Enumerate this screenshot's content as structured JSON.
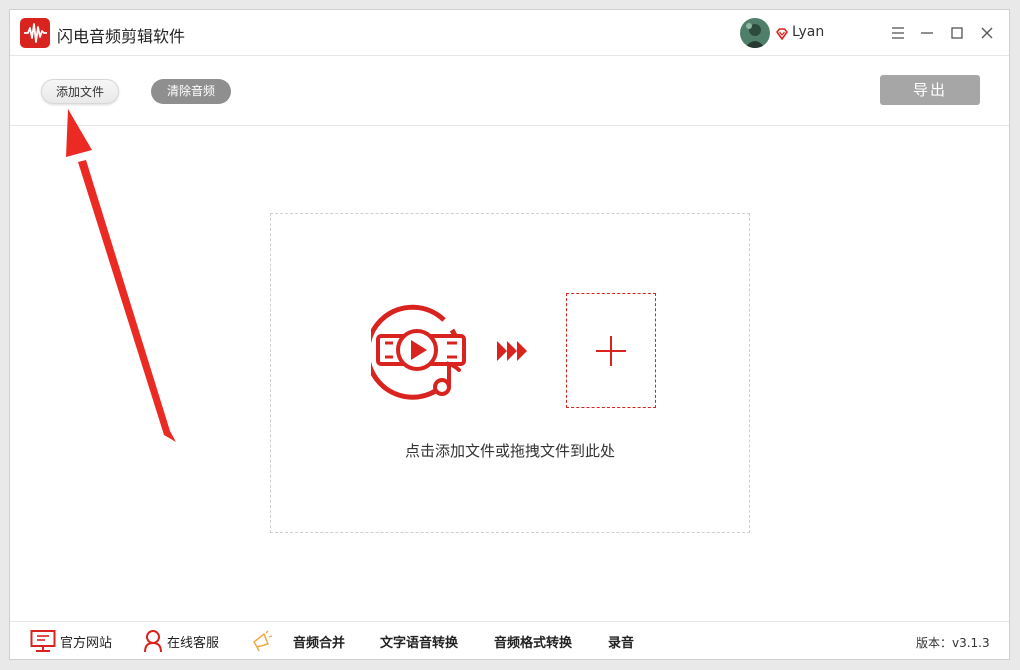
{
  "app": {
    "title": "闪电音频剪辑软件",
    "accent": "#d9231f"
  },
  "user": {
    "name": "Lyan"
  },
  "window_controls": [
    "menu-icon",
    "minimize-icon",
    "maximize-icon",
    "close-icon"
  ],
  "toolbar": {
    "add_file_label": "添加文件",
    "clear_audio_label": "清除音频",
    "export_label": "导出"
  },
  "dropzone": {
    "hint": "点击添加文件或拖拽文件到此处"
  },
  "bottom_bar": {
    "items": [
      {
        "label": "官方网站",
        "icon": "monitor-icon"
      },
      {
        "label": "在线客服",
        "icon": "person-icon"
      },
      {
        "label": "音频合并",
        "icon": "megaphone-icon"
      },
      {
        "label": "文字语音转换"
      },
      {
        "label": "音频格式转换"
      },
      {
        "label": "录音"
      }
    ],
    "version": "版本：v3.1.3"
  }
}
